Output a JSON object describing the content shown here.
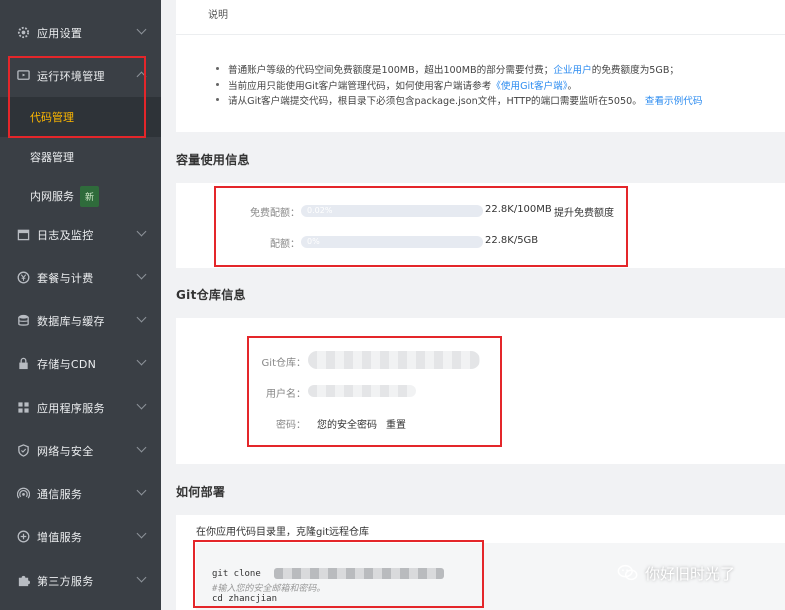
{
  "sidebar": {
    "items": [
      {
        "label": "应用设置",
        "icon": "gear-icon"
      },
      {
        "label": "运行环境管理",
        "icon": "monitor-icon"
      },
      {
        "label": "日志及监控",
        "icon": "calendar-icon"
      },
      {
        "label": "套餐与计费",
        "icon": "yen-icon"
      },
      {
        "label": "数据库与缓存",
        "icon": "database-icon"
      },
      {
        "label": "存储与CDN",
        "icon": "lock-icon"
      },
      {
        "label": "应用程序服务",
        "icon": "grid-icon"
      },
      {
        "label": "网络与安全",
        "icon": "shield-icon"
      },
      {
        "label": "通信服务",
        "icon": "signal-icon"
      },
      {
        "label": "增值服务",
        "icon": "sliders-icon"
      },
      {
        "label": "第三方服务",
        "icon": "puzzle-icon"
      }
    ],
    "sub_items": [
      {
        "label": "代码管理"
      },
      {
        "label": "容器管理"
      },
      {
        "label": "内网服务",
        "badge": "新"
      }
    ],
    "active_color": "#ffb800"
  },
  "description": {
    "label": "说明",
    "line1_a": "普通账户等级的代码空间免费额度是100MB，超出100MB的部分需要付费；",
    "line1_link": "企业用户",
    "line1_b": "的免费额度为5GB；",
    "line2_a": "当前应用只能使用Git客户端管理代码，如何使用客户端请参考",
    "line2_link": "《使用Git客户端》",
    "line2_b": "。",
    "line3_a": "请从Git客户端提交代码，根目录下必须包含package.json文件，HTTP的端口需要监听在5050。",
    "line3_link": "查看示例代码"
  },
  "capacity": {
    "title": "容量使用信息",
    "free_label": "免费配额：",
    "free_percent": "0.02%",
    "free_value": "22.8K/100MB",
    "free_link": "提升免费额度",
    "quota_label": "配额：",
    "quota_percent": "0%",
    "quota_value": "22.8K/5GB"
  },
  "git": {
    "title": "Git仓库信息",
    "repo_label": "Git仓库：",
    "user_label": "用户名：",
    "password_label": "密码：",
    "password_value": "您的安全密码",
    "reset_link": "重置"
  },
  "deploy": {
    "title": "如何部署",
    "instruction": "在你应用代码目录里，克隆git远程仓库",
    "code_line1": "git clone",
    "code_line2": "#输入您的安全邮箱和密码。",
    "code_line3": "cd zhancjian"
  },
  "watermark": {
    "text": "你好旧时光了"
  },
  "colors": {
    "link": "#2d8cf0",
    "sidebar_bg": "#3a3f45",
    "highlight_red": "#e4262a",
    "progress_fill": "#e6eaf1"
  }
}
